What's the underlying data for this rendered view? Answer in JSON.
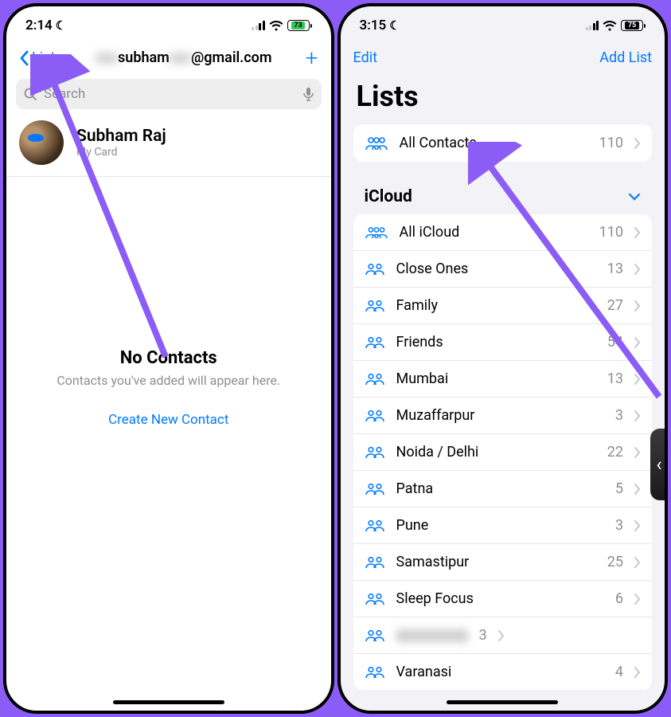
{
  "left": {
    "status": {
      "time": "2:14",
      "battery": "73"
    },
    "nav": {
      "back": "Lists",
      "title_prefix": "subham",
      "title_suffix": "@gmail.com"
    },
    "search": {
      "placeholder": "Search"
    },
    "mycard": {
      "name": "Subham Raj",
      "label": "My Card"
    },
    "empty": {
      "title": "No Contacts",
      "subtitle": "Contacts you've added will appear here.",
      "button": "Create New Contact"
    }
  },
  "right": {
    "status": {
      "time": "3:15",
      "battery": "75"
    },
    "nav": {
      "edit": "Edit",
      "addlist": "Add List"
    },
    "page_title": "Lists",
    "all_contacts": {
      "label": "All Contacts",
      "count": "110"
    },
    "section": "iCloud",
    "lists": [
      {
        "label": "All iCloud",
        "count": "110",
        "icon": "3"
      },
      {
        "label": "Close Ones",
        "count": "13",
        "icon": "2"
      },
      {
        "label": "Family",
        "count": "27",
        "icon": "2"
      },
      {
        "label": "Friends",
        "count": "54",
        "icon": "2"
      },
      {
        "label": "Mumbai",
        "count": "13",
        "icon": "2"
      },
      {
        "label": "Muzaffarpur",
        "count": "3",
        "icon": "2"
      },
      {
        "label": "Noida / Delhi",
        "count": "22",
        "icon": "2"
      },
      {
        "label": "Patna",
        "count": "5",
        "icon": "2"
      },
      {
        "label": "Pune",
        "count": "3",
        "icon": "2"
      },
      {
        "label": "Samastipur",
        "count": "25",
        "icon": "2"
      },
      {
        "label": "Sleep Focus",
        "count": "6",
        "icon": "2"
      },
      {
        "label": "",
        "count": "3",
        "icon": "2",
        "blur": true
      },
      {
        "label": "Varanasi",
        "count": "4",
        "icon": "2"
      }
    ]
  }
}
